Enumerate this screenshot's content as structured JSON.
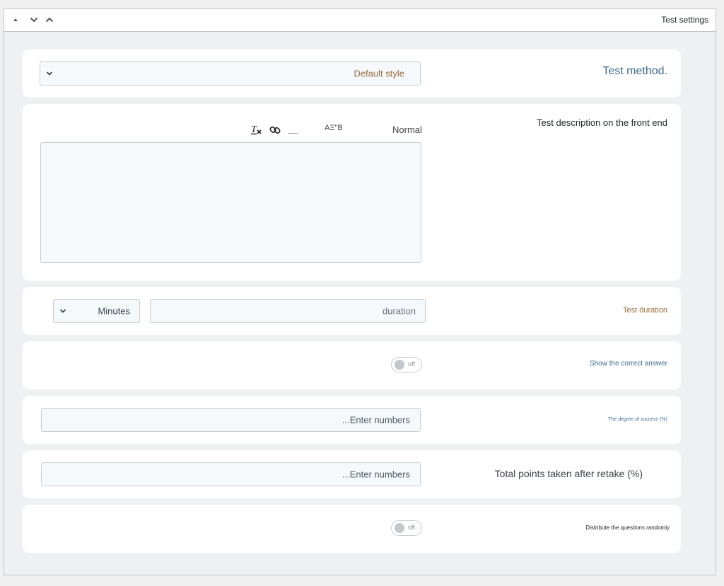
{
  "panel": {
    "title": "Test settings",
    "header_buttons": [
      {
        "icon": "triangle-up-icon"
      },
      {
        "icon": "chevron-down-icon"
      },
      {
        "icon": "chevron-up-icon"
      }
    ]
  },
  "test_method": {
    "label": "Test method.",
    "selected": "Default style"
  },
  "description": {
    "label": "Test description on the front end",
    "toolbar": {
      "clear_format_icon": "clear-formatting-icon",
      "link_icon": "link-icon",
      "direction_text": "AΞ\"B",
      "style_select": "Normal"
    },
    "value": ""
  },
  "duration": {
    "label": "Test duration",
    "unit_selected": "Minutes",
    "placeholder": "duration"
  },
  "show_answer": {
    "label": "Show the correct answer",
    "toggle_text": "off",
    "on": false
  },
  "success_degree": {
    "label": "The degree of success (%)",
    "placeholder": "...Enter numbers"
  },
  "retake_points": {
    "label": "Total points taken after retake (%)",
    "placeholder": "...Enter numbers"
  },
  "random_questions": {
    "label": "Distribute the questions randomly",
    "toggle_text": "off",
    "on": false
  },
  "colors": {
    "accent_blue": "#3d6a8f",
    "accent_brown": "#9a6d3f",
    "border": "#c8ccd1"
  }
}
